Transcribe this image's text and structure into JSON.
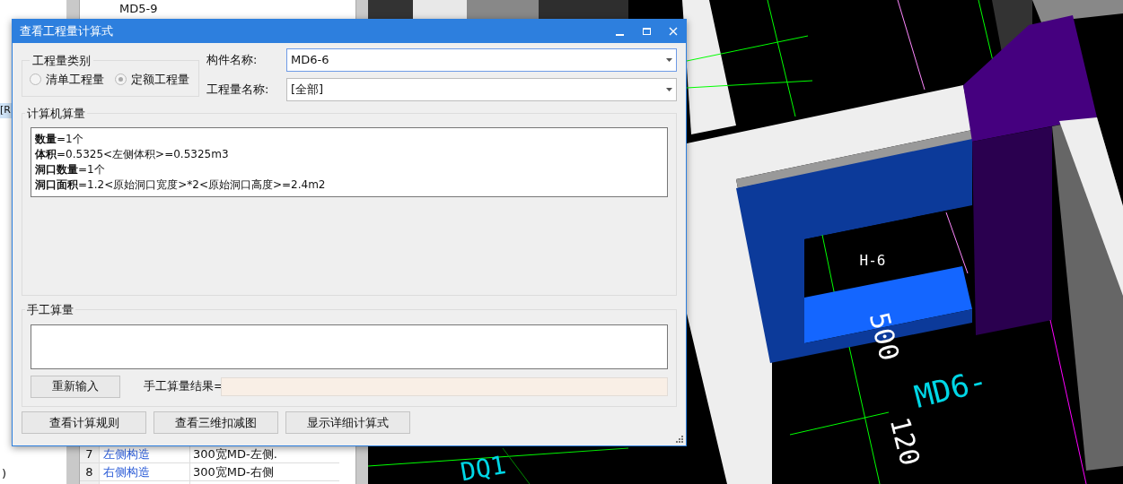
{
  "left_strip": {
    "texts": [
      "[R",
      ")"
    ]
  },
  "back_panel": {
    "list_items": [
      "MD5-9"
    ],
    "table_rows": [
      {
        "index": "7",
        "name": "左侧构造",
        "value": "300宽MD-左侧."
      },
      {
        "index": "8",
        "name": "右侧构造",
        "value": "300宽MD-右侧"
      }
    ]
  },
  "viewport": {
    "labels": [
      "H-6",
      "MD6-",
      "500",
      "120",
      "DQ1"
    ]
  },
  "dialog": {
    "title": "查看工程量计算式",
    "quantity_type": {
      "title": "工程量类别",
      "options": [
        {
          "label": "清单工程量",
          "selected": false
        },
        {
          "label": "定额工程量",
          "selected": true
        }
      ]
    },
    "component_name": {
      "label": "构件名称:",
      "value": "MD6-6",
      "focused": true
    },
    "quantity_name": {
      "label": "工程量名称:",
      "value": "[全部]",
      "focused": false
    },
    "computer": {
      "title": "计算机算量",
      "lines": [
        "**数量**=1个",
        "**体积**=0.5325<左侧体积>=0.5325m3",
        "**洞口数量**=1个",
        "**洞口面积**=1.2<原始洞口宽度>*2<原始洞口高度>=2.4m2"
      ]
    },
    "manual": {
      "title": "手工算量",
      "button": "重新输入",
      "result_label": "手工算量结果="
    },
    "buttons": [
      "查看计算规则",
      "查看三维扣减图",
      "显示详细计算式"
    ]
  }
}
